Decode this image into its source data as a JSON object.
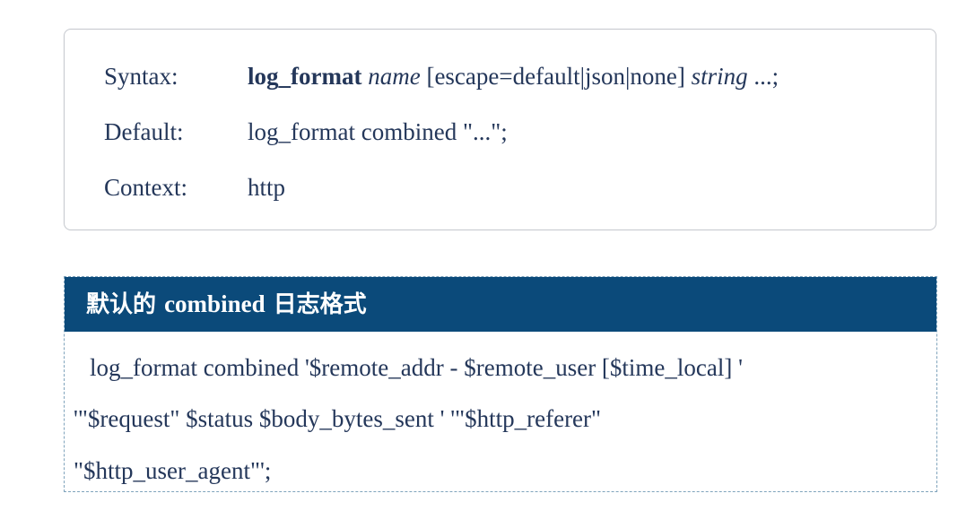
{
  "directive": {
    "syntax_label": "Syntax:",
    "syntax_keyword": "log_format",
    "syntax_param_name": "name",
    "syntax_options": "[escape=default|json|none]",
    "syntax_param_string": "string",
    "syntax_tail": "...;",
    "default_label": "Default:",
    "default_value": "log_format combined \"...\";",
    "context_label": "Context:",
    "context_value": "http"
  },
  "example": {
    "header_prefix": "默认的",
    "header_keyword": "combined",
    "header_suffix": "日志格式",
    "lines": [
      "log_format combined '$remote_addr - $remote_user [$time_local] '",
      "'\"$request\" $status $body_bytes_sent ' '\"$http_referer\"",
      "\"$http_user_agent\"';"
    ]
  }
}
